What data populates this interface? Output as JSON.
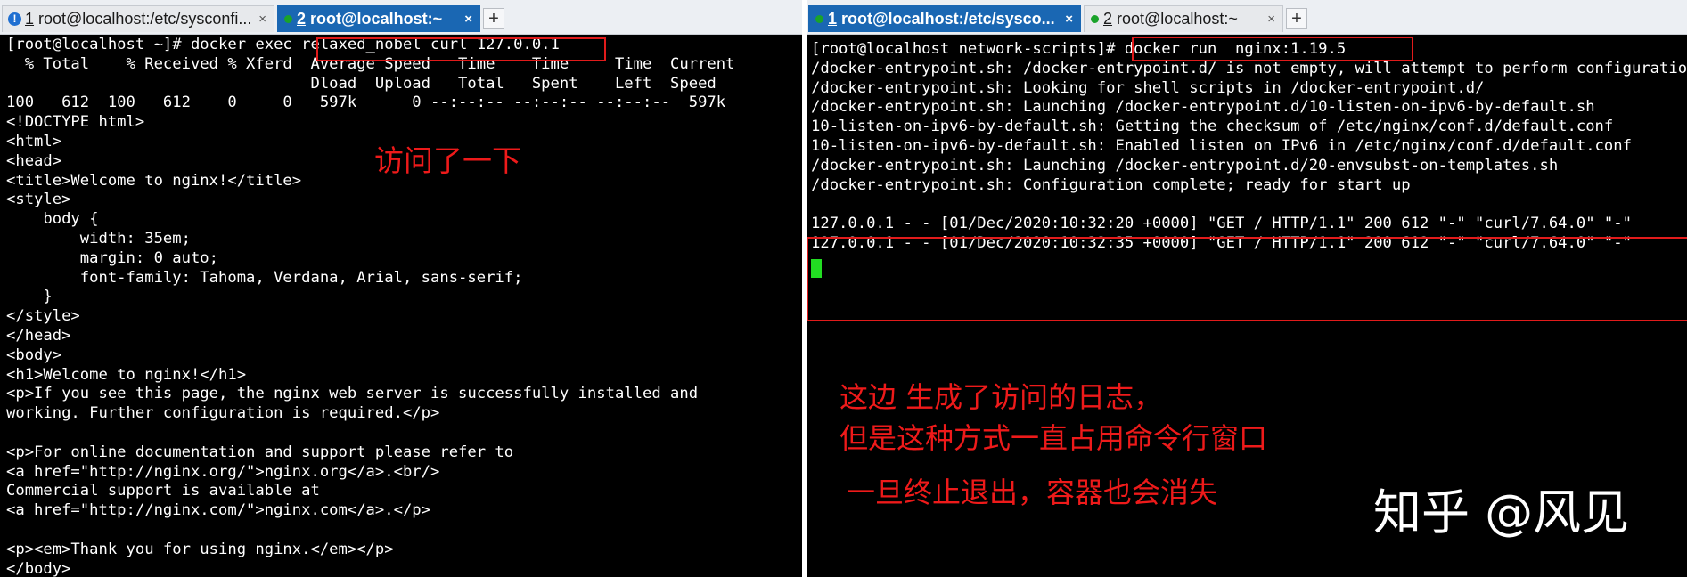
{
  "left_tabs": [
    {
      "number": "1",
      "title": "root@localhost:/etc/sysconfi...",
      "close": "×",
      "status_icon": "warning-icon"
    },
    {
      "number": "2",
      "title": "root@localhost:~",
      "close": "×",
      "status_icon": "connected-dot-icon"
    }
  ],
  "right_tabs": [
    {
      "number": "1",
      "title": "root@localhost:/etc/sysco...",
      "close": "×",
      "status_icon": "connected-dot-icon"
    },
    {
      "number": "2",
      "title": "root@localhost:~",
      "close": "×",
      "status_icon": "connected-dot-icon"
    }
  ],
  "new_tab_label": "+",
  "left_terminal": {
    "lines": [
      "[root@localhost ~]# docker exec relaxed_nobel curl 127.0.0.1",
      "  % Total    % Received % Xferd  Average Speed   Time    Time     Time  Current",
      "                                 Dload  Upload   Total   Spent    Left  Speed",
      "100   612  100   612    0     0   597k      0 --:--:-- --:--:-- --:--:--  597k",
      "<!DOCTYPE html>",
      "<html>",
      "<head>",
      "<title>Welcome to nginx!</title>",
      "<style>",
      "    body {",
      "        width: 35em;",
      "        margin: 0 auto;",
      "        font-family: Tahoma, Verdana, Arial, sans-serif;",
      "    }",
      "</style>",
      "</head>",
      "<body>",
      "<h1>Welcome to nginx!</h1>",
      "<p>If you see this page, the nginx web server is successfully installed and",
      "working. Further configuration is required.</p>",
      "",
      "<p>For online documentation and support please refer to",
      "<a href=\"http://nginx.org/\">nginx.org</a>.<br/>",
      "Commercial support is available at",
      "<a href=\"http://nginx.com/\">nginx.com</a>.</p>",
      "",
      "<p><em>Thank you for using nginx.</em></p>",
      "</body>"
    ]
  },
  "right_terminal": {
    "lines": [
      "[root@localhost network-scripts]# docker run  nginx:1.19.5",
      "/docker-entrypoint.sh: /docker-entrypoint.d/ is not empty, will attempt to perform configuration",
      "/docker-entrypoint.sh: Looking for shell scripts in /docker-entrypoint.d/",
      "/docker-entrypoint.sh: Launching /docker-entrypoint.d/10-listen-on-ipv6-by-default.sh",
      "10-listen-on-ipv6-by-default.sh: Getting the checksum of /etc/nginx/conf.d/default.conf",
      "10-listen-on-ipv6-by-default.sh: Enabled listen on IPv6 in /etc/nginx/conf.d/default.conf",
      "/docker-entrypoint.sh: Launching /docker-entrypoint.d/20-envsubst-on-templates.sh",
      "/docker-entrypoint.sh: Configuration complete; ready for start up",
      "",
      "127.0.0.1 - - [01/Dec/2020:10:32:20 +0000] \"GET / HTTP/1.1\" 200 612 \"-\" \"curl/7.64.0\" \"-\"",
      "127.0.0.1 - - [01/Dec/2020:10:32:35 +0000] \"GET / HTTP/1.1\" 200 612 \"-\" \"curl/7.64.0\" \"-\""
    ]
  },
  "annotations": {
    "left_note": "访问了一下",
    "right_note_1": "这边 生成了访问的日志，",
    "right_note_2": "但是这种方式一直占用命令行窗口",
    "right_note_3": "一旦终止退出，容器也会消失"
  },
  "watermark": "知乎 @风见",
  "colors": {
    "terminal_bg": "#000000",
    "terminal_fg": "#ffffff",
    "active_tab": "#1a67b3",
    "annotation_red": "#ee1a1a",
    "cursor_green": "#22dd22"
  }
}
